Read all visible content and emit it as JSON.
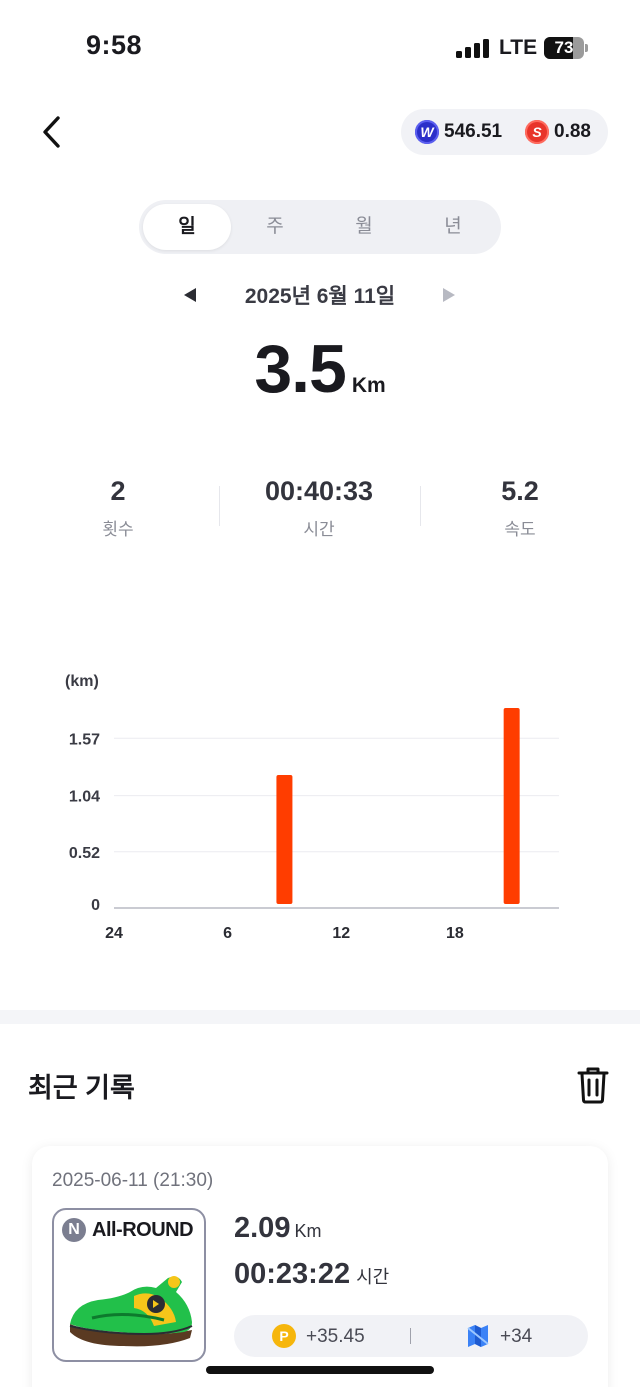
{
  "status_bar": {
    "time": "9:58",
    "network": "LTE",
    "battery": "73",
    "battery_level": 0.73
  },
  "header": {
    "back_icon": "chevron-left-icon",
    "tokens": [
      {
        "icon": "w-coin-icon",
        "value": "546.51",
        "color": "#2b2fc9"
      },
      {
        "icon": "s-coin-icon",
        "value": "0.88",
        "color": "#e8342a"
      }
    ]
  },
  "period_tabs": [
    {
      "label": "일",
      "active": true
    },
    {
      "label": "주",
      "active": false
    },
    {
      "label": "월",
      "active": false
    },
    {
      "label": "년",
      "active": false
    }
  ],
  "date_nav": {
    "label": "2025년 6월 11일",
    "prev_icon": "triangle-left-icon",
    "next_icon": "triangle-right-icon"
  },
  "summary": {
    "distance": "3.5",
    "distance_unit": "Km",
    "stats": [
      {
        "value": "2",
        "label": "횟수"
      },
      {
        "value": "00:40:33",
        "label": "시간"
      },
      {
        "value": "5.2",
        "label": "속도"
      }
    ]
  },
  "chart_data": {
    "type": "bar",
    "ylabel": "(km)",
    "y_ticks": [
      "0",
      "0.52",
      "1.04",
      "1.57"
    ],
    "ylim": [
      0,
      1.85
    ],
    "x_ticks": [
      {
        "label": "24",
        "hour": 0
      },
      {
        "label": "6",
        "hour": 6
      },
      {
        "label": "12",
        "hour": 12
      },
      {
        "label": "18",
        "hour": 18
      }
    ],
    "xlim": [
      0,
      23.5
    ],
    "bars": [
      {
        "hour": 9,
        "value": 1.23
      },
      {
        "hour": 21,
        "value": 1.85
      }
    ],
    "bar_color": "#ff3d00",
    "grid": true
  },
  "recent": {
    "title": "최근 기록",
    "trash_icon": "trash-icon",
    "records": [
      {
        "datetime": "2025-06-11 (21:30)",
        "shoe_badge": "N",
        "shoe_name": "All-ROUND",
        "distance": "2.09",
        "distance_unit": "Km",
        "time": "00:23:22",
        "time_unit": "시간",
        "reward_p_icon": "P",
        "reward_p": "+35.45",
        "reward_map": "+34"
      }
    ]
  },
  "colors": {
    "accent": "#ff3d00",
    "text": "#1a1a1f",
    "muted": "#8a8c96",
    "pill_bg": "#f1f2f6"
  }
}
